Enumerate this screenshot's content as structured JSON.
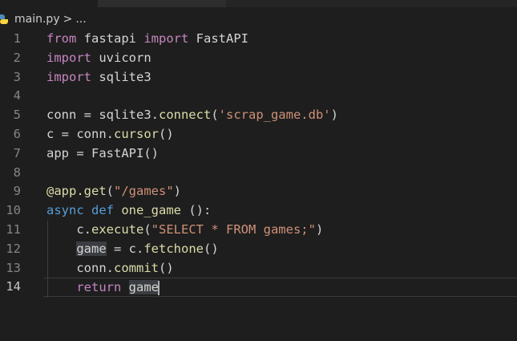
{
  "breadcrumb": {
    "file": "main.py",
    "separator": ">",
    "more": "..."
  },
  "line_numbers": [
    "1",
    "2",
    "3",
    "4",
    "5",
    "6",
    "7",
    "8",
    "9",
    "10",
    "11",
    "12",
    "13",
    "14"
  ],
  "code": {
    "l1": {
      "kw": "from",
      "mod": " fastapi ",
      "kw2": "import",
      "name": " FastAPI"
    },
    "l2": {
      "kw": "import",
      "name": " uvicorn"
    },
    "l3": {
      "kw": "import",
      "name": " sqlite3"
    },
    "l5": {
      "a": "conn = sqlite3.",
      "fn": "connect",
      "b": "(",
      "str": "'scrap_game.db'",
      "c": ")"
    },
    "l6": {
      "a": "c = conn.",
      "fn": "cursor",
      "b": "()"
    },
    "l7": {
      "a": "app = FastAPI()"
    },
    "l9": {
      "dec": "@app.get",
      "b": "(",
      "str": "\"/games\"",
      "c": ")"
    },
    "l10": {
      "kw": "async",
      "kw2": " def ",
      "fn": "one_game",
      "b": " ():"
    },
    "l11": {
      "indent": "    ",
      "a": "c.",
      "fn": "execute",
      "b": "(",
      "str": "\"SELECT * FROM games;\"",
      "c": ")"
    },
    "l12": {
      "indent": "    ",
      "var": "game",
      "a": " = c.",
      "fn": "fetchone",
      "b": "()"
    },
    "l13": {
      "indent": "    ",
      "a": "conn.",
      "fn": "commit",
      "b": "()"
    },
    "l14": {
      "indent": "    ",
      "kw": "return",
      "sp": " ",
      "var": "game"
    }
  }
}
